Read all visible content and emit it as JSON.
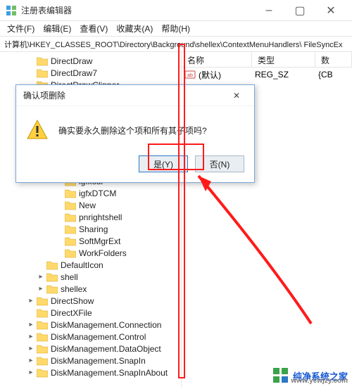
{
  "window": {
    "title": "注册表编辑器",
    "minimize": "–",
    "maximize": "▢",
    "close": "✕"
  },
  "menu": {
    "file": "文件(F)",
    "edit": "编辑(E)",
    "view": "查看(V)",
    "fav": "收藏夹(A)",
    "help": "帮助(H)"
  },
  "address": "计算机\\HKEY_CLASSES_ROOT\\Directory\\Background\\shellex\\ContextMenuHandlers\\ FileSyncEx",
  "tree": {
    "items": [
      {
        "pad": 38,
        "exp": "",
        "label": "DirectDraw"
      },
      {
        "pad": 38,
        "exp": "",
        "label": "DirectDraw7"
      },
      {
        "pad": 38,
        "exp": "",
        "label": "DirectDrawClipper"
      },
      {
        "pad": 78,
        "exp": "",
        "label": "igfxcui"
      },
      {
        "pad": 78,
        "exp": "",
        "label": "igfxDTCM"
      },
      {
        "pad": 78,
        "exp": "",
        "label": "New"
      },
      {
        "pad": 78,
        "exp": "",
        "label": "pnrightshell"
      },
      {
        "pad": 78,
        "exp": "",
        "label": "Sharing"
      },
      {
        "pad": 78,
        "exp": "",
        "label": "SoftMgrExt"
      },
      {
        "pad": 78,
        "exp": "",
        "label": "WorkFolders"
      },
      {
        "pad": 52,
        "exp": "",
        "label": "DefaultIcon"
      },
      {
        "pad": 52,
        "exp": "▸",
        "label": "shell"
      },
      {
        "pad": 52,
        "exp": "▸",
        "label": "shellex"
      },
      {
        "pad": 38,
        "exp": "▸",
        "label": "DirectShow"
      },
      {
        "pad": 38,
        "exp": "",
        "label": "DirectXFile"
      },
      {
        "pad": 38,
        "exp": "▸",
        "label": "DiskManagement.Connection"
      },
      {
        "pad": 38,
        "exp": "▸",
        "label": "DiskManagement.Control"
      },
      {
        "pad": 38,
        "exp": "▸",
        "label": "DiskManagement.DataObject"
      },
      {
        "pad": 38,
        "exp": "▸",
        "label": "DiskManagement.SnapIn"
      },
      {
        "pad": 38,
        "exp": "▸",
        "label": "DiskManagement.SnapInAbout"
      }
    ]
  },
  "list": {
    "headers": {
      "name": "名称",
      "type": "类型",
      "data": "数"
    },
    "rows": [
      {
        "name": "(默认)",
        "type": "REG_SZ",
        "data": "{CB"
      }
    ]
  },
  "dialog": {
    "title": "确认项删除",
    "message": "确实要永久删除这个项和所有其子项吗?",
    "yes": "是(Y)",
    "no": "否(N)",
    "close": "✕"
  },
  "watermark": {
    "text": "纯净系统之家",
    "url": "www.ycwjzy.com"
  }
}
